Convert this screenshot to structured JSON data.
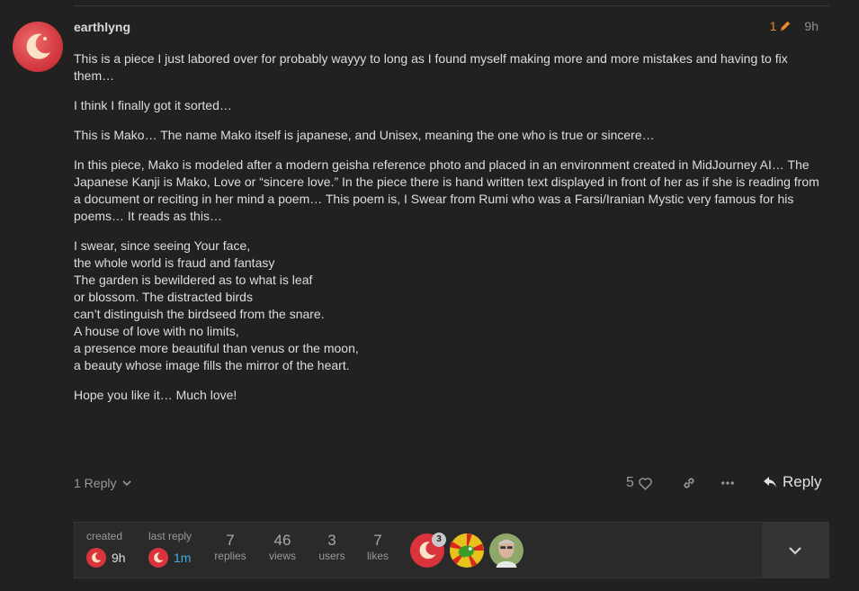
{
  "post": {
    "username": "earthlyng",
    "edit_count": "1",
    "age": "9h",
    "paragraphs": [
      "This is a piece I just labored over for probably wayyy to long as I found myself making more and more mistakes and having to fix them…",
      "I think I finally got it sorted…",
      "This is Mako… The name Mako itself is japanese, and Unisex, meaning the one who is true or sincere…",
      "In this piece, Mako is modeled after a modern geisha reference photo and placed in an environment created in MidJourney AI… The Japanese Kanji is Mako, Love or “sincere love.” In the piece there is hand written text displayed in front of her as if she is reading from a document or reciting in her mind a poem… This poem is, I Swear from Rumi who was a Farsi/Iranian Mystic very famous for his poems… It reads as this…"
    ],
    "poem": [
      "I swear, since seeing Your face,",
      "the whole world is fraud and fantasy",
      "The garden is bewildered as to what is leaf",
      "or blossom. The distracted birds",
      "can’t distinguish the birdseed from the snare.",
      "A house of love with no limits,",
      "a presence more beautiful than venus or the moon,",
      "a beauty whose image fills the mirror of the heart."
    ],
    "closing": "Hope you like it… Much love!"
  },
  "actions": {
    "replies_label": "1 Reply",
    "like_count": "5",
    "reply_label": "Reply",
    "icons": [
      "chevron-down-icon",
      "heart-icon",
      "link-icon",
      "ellipsis-icon",
      "reply-arrow-icon"
    ]
  },
  "topic_map": {
    "created_label": "created",
    "created_value": "9h",
    "last_reply_label": "last reply",
    "last_reply_value": "1m",
    "stats": [
      {
        "value": "7",
        "label": "replies"
      },
      {
        "value": "46",
        "label": "views"
      },
      {
        "value": "3",
        "label": "users"
      },
      {
        "value": "7",
        "label": "likes"
      }
    ],
    "participant_badge": "3"
  },
  "colors": {
    "background": "#212121",
    "accent_orange": "#e88a2e",
    "link_blue": "#3ab0e0",
    "avatar_red": "#e03a3e"
  }
}
